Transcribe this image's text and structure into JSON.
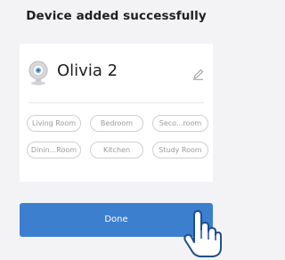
{
  "dialog": {
    "title": "Device added successfully"
  },
  "device": {
    "icon": "camera-icon",
    "name": "Olivia 2",
    "edit_icon": "pencil-icon"
  },
  "rooms": [
    {
      "label": "Living Room"
    },
    {
      "label": "Bedroom"
    },
    {
      "label": "Seco...room"
    },
    {
      "label": "Dinin...Room"
    },
    {
      "label": "Kitchen"
    },
    {
      "label": "Study Room"
    }
  ],
  "actions": {
    "done_label": "Done"
  },
  "colors": {
    "accent": "#3d7fcf",
    "background": "#f3f3f5",
    "chip_border": "#cfcfcf",
    "chip_text": "#9a9a9a"
  },
  "pointer": "hand-cursor-icon"
}
